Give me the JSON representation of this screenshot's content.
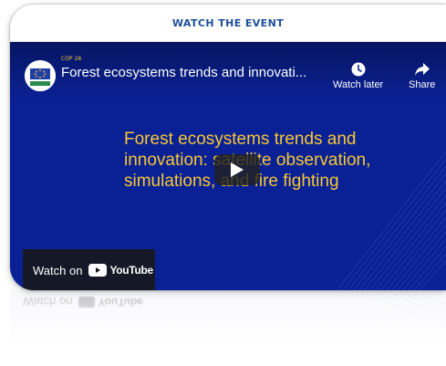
{
  "header": {
    "title": "WATCH THE EVENT"
  },
  "player": {
    "channel_badge": "COP 28",
    "title": "Forest ecosystems trends and innovati...",
    "watch_later_label": "Watch later",
    "share_label": "Share",
    "headline": "Forest ecosystems trends and innovation: satellite observation, simulations, and fire fighting",
    "watch_on_label": "Watch on",
    "platform_label": "YouTube"
  },
  "colors": {
    "accent_header": "#1d4f9a",
    "video_background": "#0a2196",
    "headline_text": "#f6c733",
    "youtube_red": "#ff0000"
  },
  "icons": {
    "watch_later": "clock-icon",
    "share": "share-arrow-icon",
    "play": "play-icon",
    "youtube": "youtube-logo-icon"
  }
}
